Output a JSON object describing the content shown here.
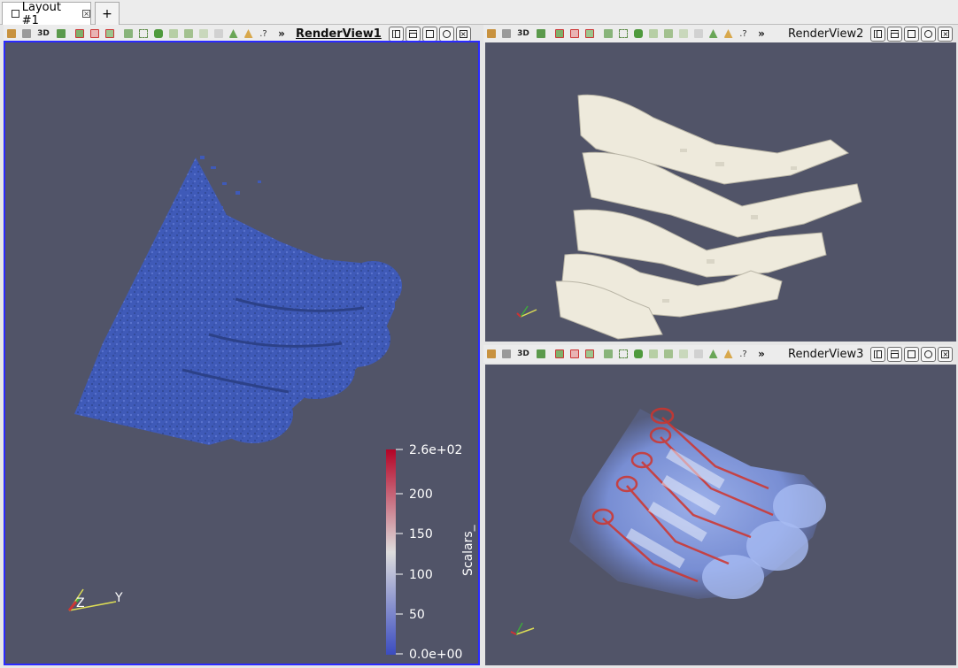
{
  "tabs": [
    {
      "label": "Layout #1",
      "active": true
    },
    {
      "label": "+",
      "active": false
    }
  ],
  "views": [
    {
      "title": "RenderView1",
      "active": true,
      "legend": {
        "title": "Scalars_",
        "colormap": [
          "#3b4cc0",
          "#dddddd",
          "#b40426"
        ],
        "tick_labels": [
          "2.6e+02",
          "200",
          "150",
          "100",
          "50",
          "0.0e+00"
        ]
      },
      "axes_labels": [
        "Z",
        "Y"
      ],
      "surface_color": "#3f5ab8"
    },
    {
      "title": "RenderView2",
      "active": false,
      "surface_color": "#eeeadc"
    },
    {
      "title": "RenderView3",
      "active": false
    }
  ],
  "toolbar_icons": [
    "pick-icon",
    "select-icon",
    "3d-toggle-icon",
    "camera-icon",
    "select-cells-icon",
    "select-points-icon",
    "frustum-icon",
    "interactive-select-icon",
    "block-select-icon",
    "polygon-select-icon",
    "hover-cells-icon",
    "hover-points-icon",
    "grow-selection-icon",
    "clear-selection-icon",
    "ruler-icon",
    "help-icon"
  ],
  "toolbar_3d_label": "3D",
  "toolbar_more_label": "»",
  "window_buttons": [
    "split-horizontal-icon",
    "split-vertical-icon",
    "maximize-icon",
    "screenshot-icon",
    "close-icon"
  ],
  "colors": {
    "background": "#515468",
    "active_border": "#2a2aff"
  }
}
